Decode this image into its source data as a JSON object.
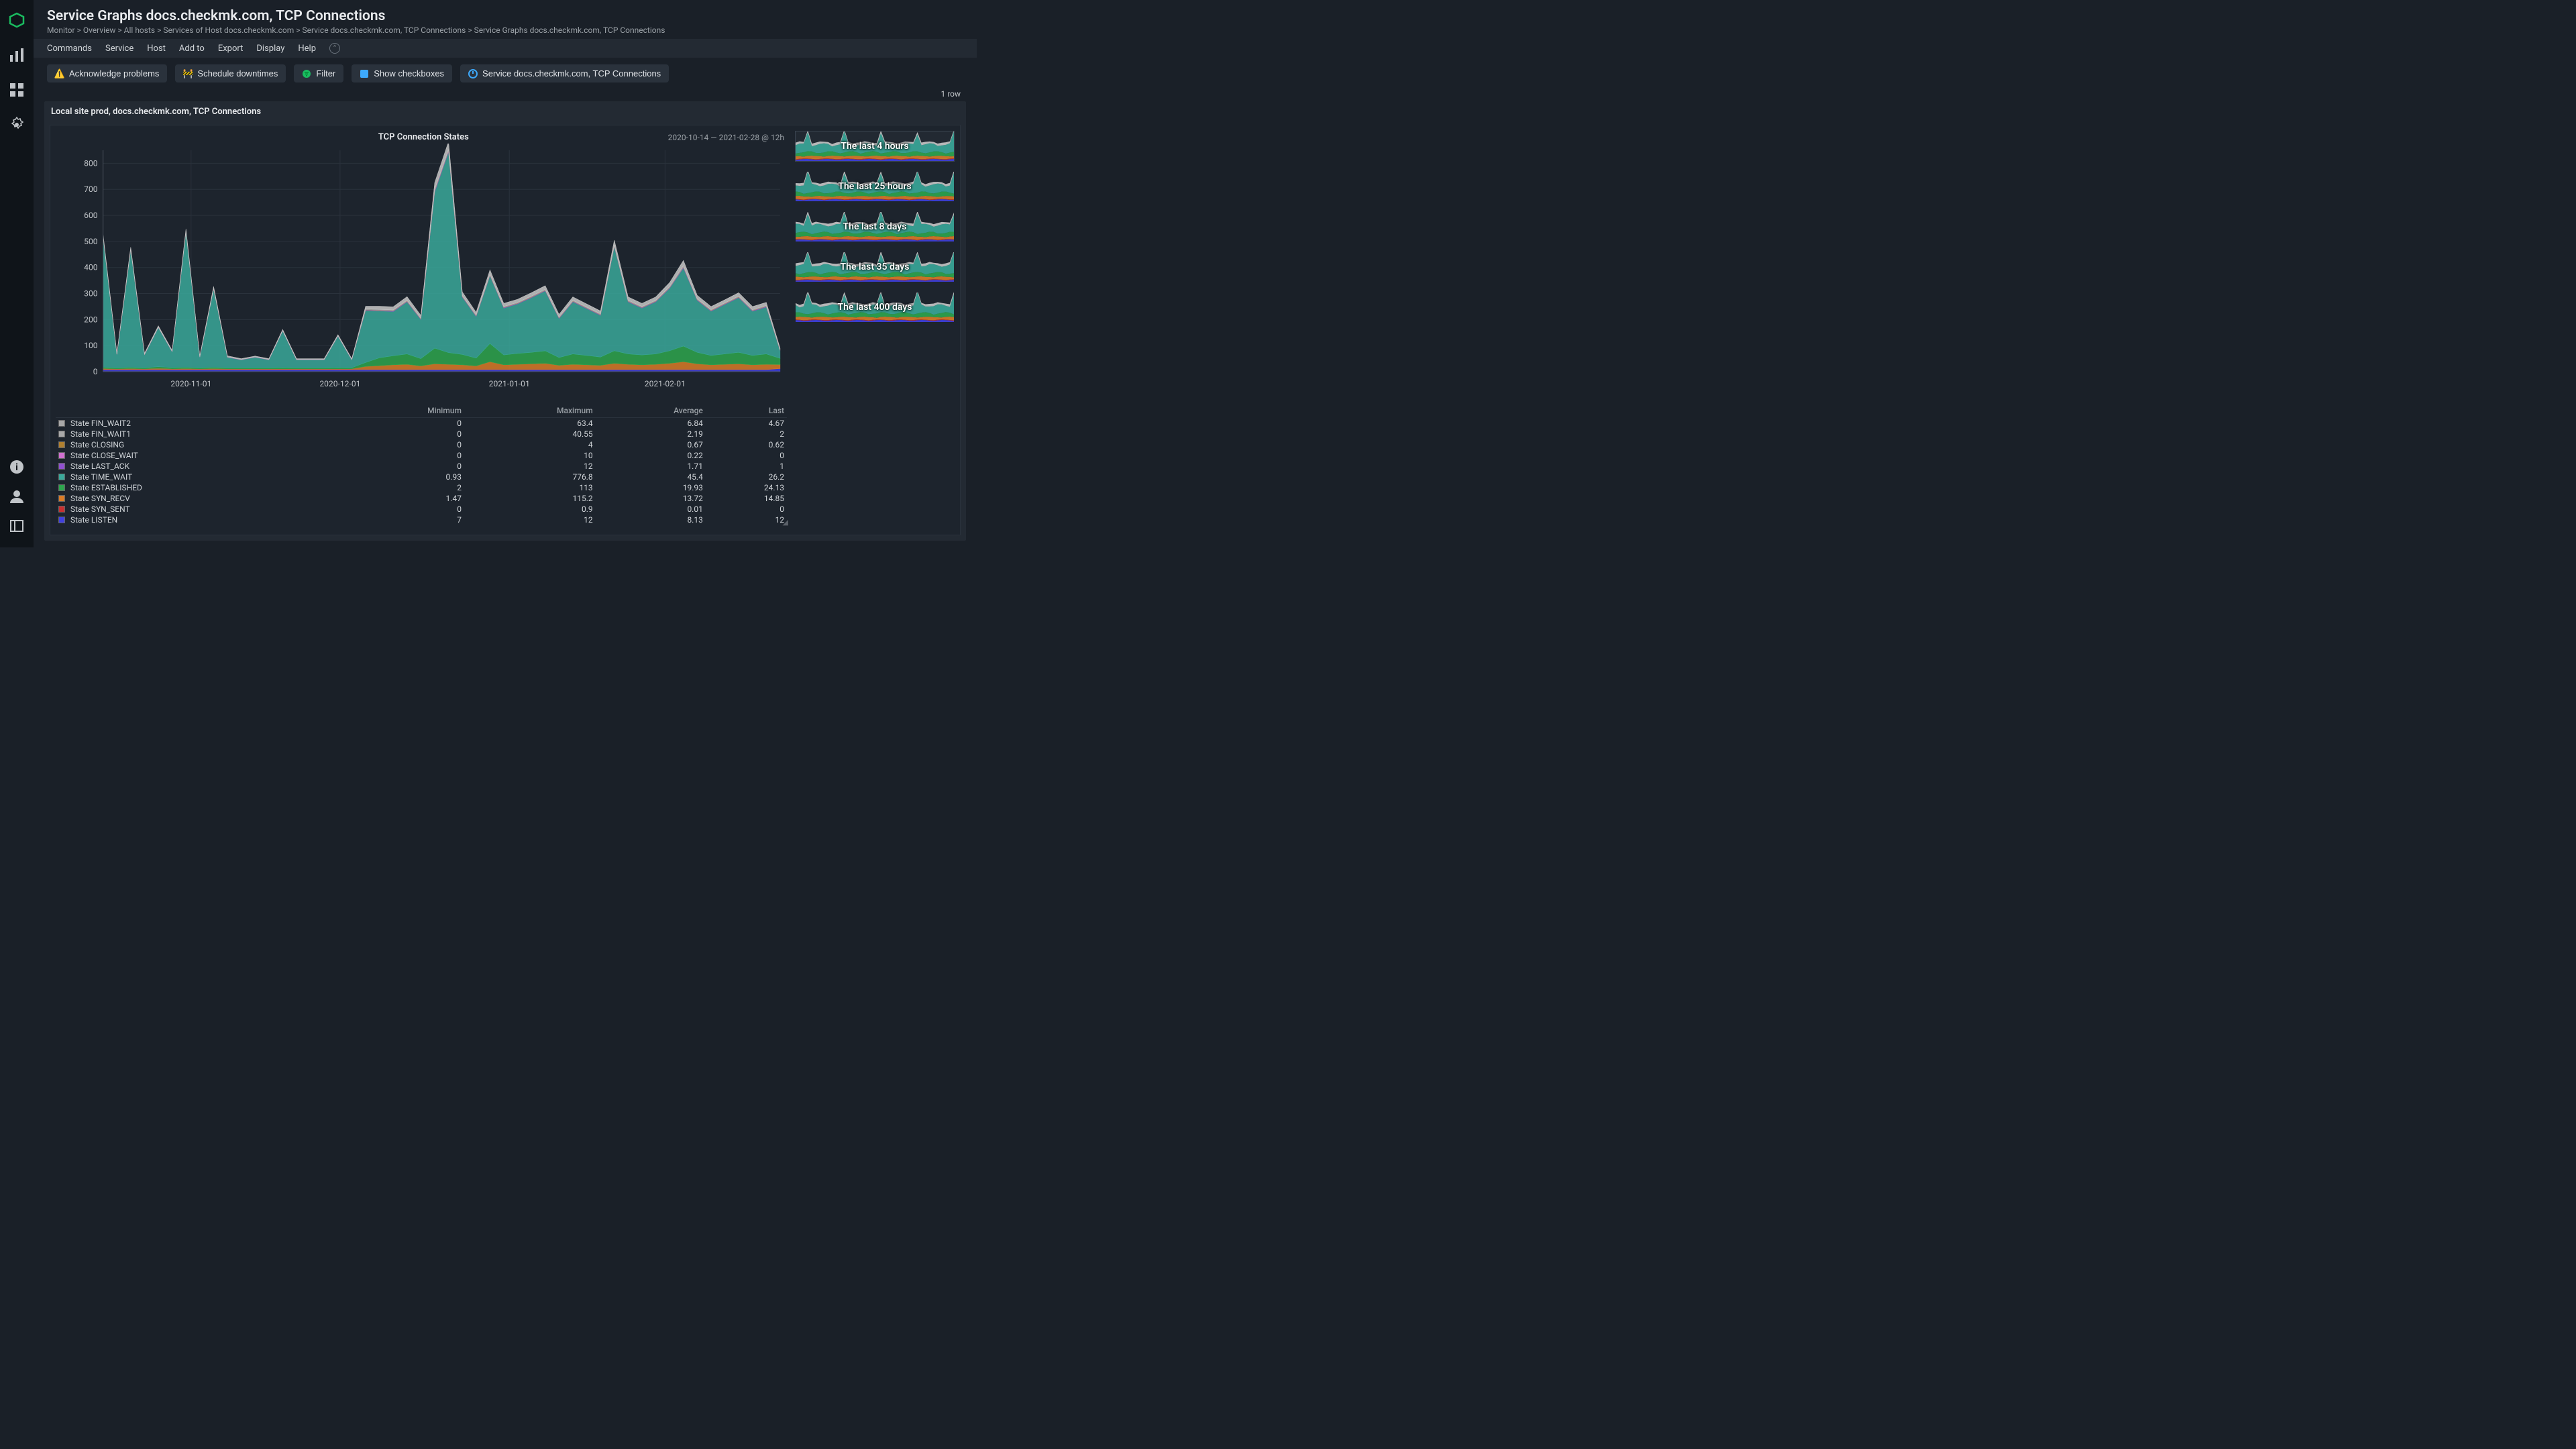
{
  "page": {
    "title": "Service Graphs docs.checkmk.com, TCP Connections",
    "breadcrumb": "Monitor > Overview > All hosts > Services of Host docs.checkmk.com > Service docs.checkmk.com, TCP Connections > Service Graphs docs.checkmk.com, TCP Connections"
  },
  "menu": {
    "items": [
      "Commands",
      "Service",
      "Host",
      "Add to",
      "Export",
      "Display",
      "Help"
    ]
  },
  "toolbar": {
    "ack": "Acknowledge problems",
    "sched": "Schedule downtimes",
    "filter": "Filter",
    "checkboxes": "Show checkboxes",
    "service": "Service docs.checkmk.com, TCP Connections"
  },
  "row_count": "1 row",
  "panel_header": "Local site prod, docs.checkmk.com, TCP Connections",
  "chart": {
    "title": "TCP Connection States",
    "range": "2020-10-14 — 2021-02-28 @ 12h"
  },
  "thumbs": [
    {
      "label": "The last 4 hours"
    },
    {
      "label": "The last 25 hours"
    },
    {
      "label": "The last 8 days"
    },
    {
      "label": "The last 35 days"
    },
    {
      "label": "The last 400 days"
    }
  ],
  "legend": {
    "columns": [
      "",
      "Minimum",
      "Maximum",
      "Average",
      "Last"
    ],
    "rows": [
      {
        "name": "State FIN_WAIT2",
        "color": "#a8a8a8",
        "min": "0",
        "max": "63.4",
        "avg": "6.84",
        "last": "4.67"
      },
      {
        "name": "State FIN_WAIT1",
        "color": "#a8a8a8",
        "min": "0",
        "max": "40.55",
        "avg": "2.19",
        "last": "2"
      },
      {
        "name": "State CLOSING",
        "color": "#b08030",
        "min": "0",
        "max": "4",
        "avg": "0.67",
        "last": "0.62"
      },
      {
        "name": "State CLOSE_WAIT",
        "color": "#d070d0",
        "min": "0",
        "max": "10",
        "avg": "0.22",
        "last": "0"
      },
      {
        "name": "State LAST_ACK",
        "color": "#9050d0",
        "min": "0",
        "max": "12",
        "avg": "1.71",
        "last": "1"
      },
      {
        "name": "State TIME_WAIT",
        "color": "#3aa89a",
        "min": "0.93",
        "max": "776.8",
        "avg": "45.4",
        "last": "26.2"
      },
      {
        "name": "State ESTABLISHED",
        "color": "#2ea64e",
        "min": "2",
        "max": "113",
        "avg": "19.93",
        "last": "24.13"
      },
      {
        "name": "State SYN_RECV",
        "color": "#d97b27",
        "min": "1.47",
        "max": "115.2",
        "avg": "13.72",
        "last": "14.85"
      },
      {
        "name": "State SYN_SENT",
        "color": "#c83030",
        "min": "0",
        "max": "0.9",
        "avg": "0.01",
        "last": "0"
      },
      {
        "name": "State LISTEN",
        "color": "#4040e0",
        "min": "7",
        "max": "12",
        "avg": "8.13",
        "last": "12"
      }
    ]
  },
  "chart_data": {
    "type": "area",
    "title": "TCP Connection States",
    "xlabel": "",
    "ylabel": "",
    "ylim": [
      0,
      850
    ],
    "y_ticks": [
      0,
      100,
      200,
      300,
      400,
      500,
      600,
      700,
      800
    ],
    "x_ticks": [
      "2020-11-01",
      "2020-12-01",
      "2021-01-01",
      "2021-02-01"
    ],
    "x_range": [
      "2020-10-14",
      "2021-02-28"
    ],
    "series": [
      {
        "name": "State LISTEN",
        "color": "#4040e0",
        "values": [
          8,
          8,
          8,
          8,
          8,
          8,
          8,
          8,
          8,
          8,
          8,
          8,
          8,
          8,
          8,
          8,
          8,
          8,
          8,
          8,
          8,
          8,
          8,
          8,
          8,
          8,
          8,
          8,
          8,
          8,
          8,
          8,
          8,
          8,
          8,
          8,
          8,
          8,
          8,
          8,
          8,
          8,
          8,
          8,
          8,
          8,
          8,
          8,
          8,
          12
        ]
      },
      {
        "name": "State SYN_SENT",
        "color": "#c83030",
        "values": [
          0,
          0,
          0,
          0,
          0,
          0,
          0,
          0,
          0,
          0,
          0,
          0,
          0,
          0,
          0,
          0,
          0,
          0,
          0,
          0,
          0,
          0,
          0,
          0,
          0,
          0,
          0,
          0,
          0,
          0,
          0,
          0,
          0,
          0,
          0,
          0,
          0,
          0,
          0,
          0,
          0,
          0,
          0,
          0,
          0,
          0,
          0,
          0,
          0,
          0
        ]
      },
      {
        "name": "State SYN_RECV",
        "color": "#d97b27",
        "values": [
          4,
          3,
          4,
          3,
          5,
          3,
          4,
          3,
          4,
          3,
          3,
          3,
          3,
          3,
          3,
          3,
          3,
          3,
          3,
          12,
          15,
          18,
          20,
          14,
          22,
          20,
          18,
          14,
          30,
          18,
          20,
          22,
          24,
          16,
          20,
          18,
          16,
          24,
          20,
          18,
          20,
          24,
          30,
          22,
          18,
          20,
          22,
          18,
          20,
          15
        ]
      },
      {
        "name": "State ESTABLISHED",
        "color": "#2ea64e",
        "values": [
          5,
          4,
          5,
          4,
          6,
          5,
          5,
          4,
          5,
          4,
          4,
          4,
          4,
          5,
          4,
          4,
          4,
          5,
          4,
          15,
          30,
          35,
          40,
          28,
          60,
          45,
          40,
          30,
          70,
          38,
          42,
          44,
          48,
          30,
          40,
          36,
          32,
          48,
          40,
          38,
          40,
          48,
          60,
          44,
          36,
          40,
          44,
          36,
          40,
          24
        ]
      },
      {
        "name": "State TIME_WAIT",
        "color": "#3aa89a",
        "values": [
          500,
          50,
          450,
          50,
          150,
          60,
          520,
          40,
          300,
          40,
          30,
          40,
          30,
          140,
          30,
          30,
          30,
          120,
          30,
          200,
          180,
          170,
          200,
          150,
          600,
          770,
          220,
          160,
          260,
          180,
          190,
          210,
          230,
          150,
          200,
          180,
          160,
          400,
          200,
          180,
          200,
          240,
          300,
          200,
          170,
          190,
          210,
          170,
          180,
          30
        ]
      },
      {
        "name": "State LAST_ACK",
        "color": "#9050d0",
        "values": [
          1,
          1,
          1,
          1,
          1,
          1,
          1,
          1,
          1,
          1,
          1,
          1,
          1,
          1,
          1,
          1,
          1,
          1,
          1,
          2,
          2,
          2,
          2,
          2,
          3,
          3,
          2,
          2,
          2,
          2,
          2,
          2,
          2,
          2,
          2,
          2,
          2,
          2,
          2,
          2,
          2,
          2,
          3,
          2,
          2,
          2,
          2,
          2,
          2,
          1
        ]
      },
      {
        "name": "State CLOSE_WAIT",
        "color": "#d070d0",
        "values": [
          0,
          0,
          0,
          0,
          0,
          0,
          0,
          0,
          0,
          0,
          0,
          0,
          0,
          0,
          0,
          0,
          0,
          0,
          0,
          0,
          0,
          0,
          0,
          0,
          1,
          1,
          0,
          0,
          0,
          0,
          0,
          0,
          0,
          0,
          0,
          0,
          0,
          0,
          0,
          0,
          0,
          0,
          0,
          0,
          0,
          0,
          0,
          0,
          0,
          0
        ]
      },
      {
        "name": "State CLOSING",
        "color": "#b08030",
        "values": [
          0,
          0,
          0,
          0,
          0,
          0,
          0,
          0,
          0,
          0,
          0,
          0,
          0,
          0,
          0,
          0,
          0,
          0,
          0,
          1,
          1,
          1,
          1,
          1,
          1,
          1,
          1,
          1,
          1,
          1,
          1,
          1,
          1,
          1,
          1,
          1,
          1,
          1,
          1,
          1,
          1,
          1,
          1,
          1,
          1,
          1,
          1,
          1,
          1,
          1
        ]
      },
      {
        "name": "State FIN_WAIT1",
        "color": "#a8a8a8",
        "values": [
          2,
          1,
          2,
          1,
          1,
          1,
          2,
          1,
          2,
          1,
          1,
          1,
          1,
          1,
          1,
          1,
          1,
          1,
          1,
          3,
          3,
          3,
          3,
          3,
          6,
          5,
          3,
          3,
          4,
          3,
          3,
          3,
          3,
          3,
          3,
          3,
          3,
          4,
          3,
          3,
          3,
          4,
          5,
          3,
          3,
          3,
          3,
          3,
          3,
          2
        ]
      },
      {
        "name": "State FIN_WAIT2",
        "color": "#c8c8c8",
        "values": [
          8,
          4,
          8,
          4,
          5,
          4,
          8,
          4,
          7,
          4,
          3,
          3,
          3,
          4,
          3,
          3,
          3,
          4,
          3,
          10,
          12,
          12,
          14,
          10,
          25,
          30,
          14,
          10,
          16,
          12,
          12,
          13,
          14,
          10,
          13,
          12,
          11,
          18,
          13,
          12,
          13,
          15,
          20,
          13,
          12,
          12,
          13,
          12,
          12,
          5
        ]
      }
    ]
  }
}
